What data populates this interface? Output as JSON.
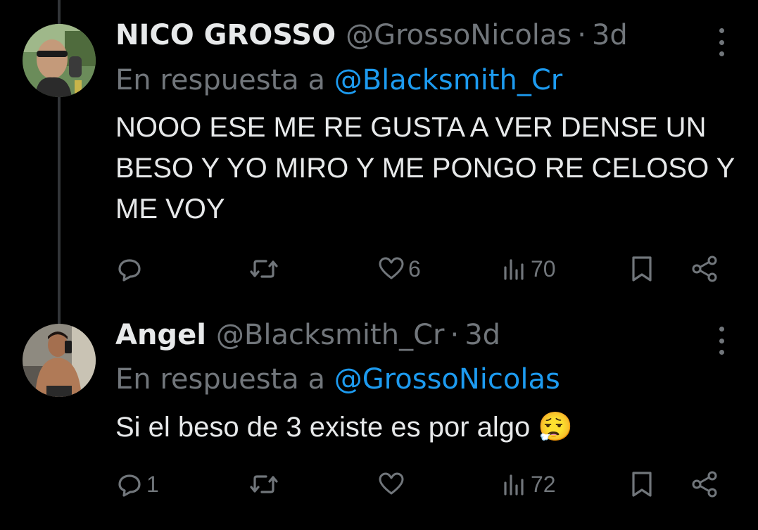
{
  "tweets": [
    {
      "name": "NICO GROSSO",
      "handle": "@GrossoNicolas",
      "separator": "·",
      "time": "3d",
      "reply_prefix": "En respuesta a",
      "reply_to": "@Blacksmith_Cr",
      "text": "NOOO ESE ME RE GUSTA A VER DENSE UN BESO Y YO MIRO Y ME PONGO RE CELOSO Y ME VOY",
      "replies": "",
      "retweets": "",
      "likes": "6",
      "views": "70"
    },
    {
      "name": "Angel",
      "handle": "@Blacksmith_Cr",
      "separator": "·",
      "time": "3d",
      "reply_prefix": "En respuesta a",
      "reply_to": "@GrossoNicolas",
      "text": "Si el beso de 3 existe es por algo 😮‍💨",
      "replies": "1",
      "retweets": "",
      "likes": "",
      "views": "72"
    }
  ],
  "icons": [
    "reply-icon",
    "retweet-icon",
    "like-icon",
    "views-icon",
    "bookmark-icon",
    "share-icon",
    "more-icon"
  ],
  "colors": {
    "background": "#000000",
    "text": "#e7e9ea",
    "secondary": "#71767b",
    "mention": "#1d9bf0",
    "thread_line": "#333639"
  }
}
